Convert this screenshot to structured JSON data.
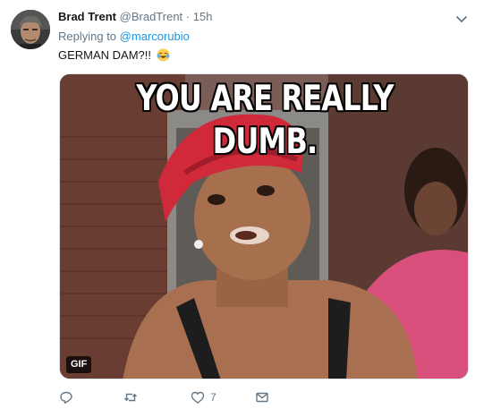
{
  "tweet": {
    "display_name": "Brad Trent",
    "handle": "@BradTrent",
    "separator": "·",
    "time": "15h",
    "reply_prefix": "Replying to",
    "reply_handle": "@marcorubio",
    "text": "GERMAN DAM?!!",
    "text_emoji": "face-with-tears-of-joy-icon"
  },
  "media": {
    "caption": "YOU ARE REALLY DUMB.",
    "badge": "GIF"
  },
  "actions": {
    "reply_icon": "reply-icon",
    "retweet_icon": "retweet-icon",
    "like_icon": "heart-icon",
    "like_count": "7",
    "message_icon": "envelope-icon"
  },
  "colors": {
    "link": "#1b95e0",
    "secondary_text": "#657786",
    "primary_text": "#14171a"
  }
}
